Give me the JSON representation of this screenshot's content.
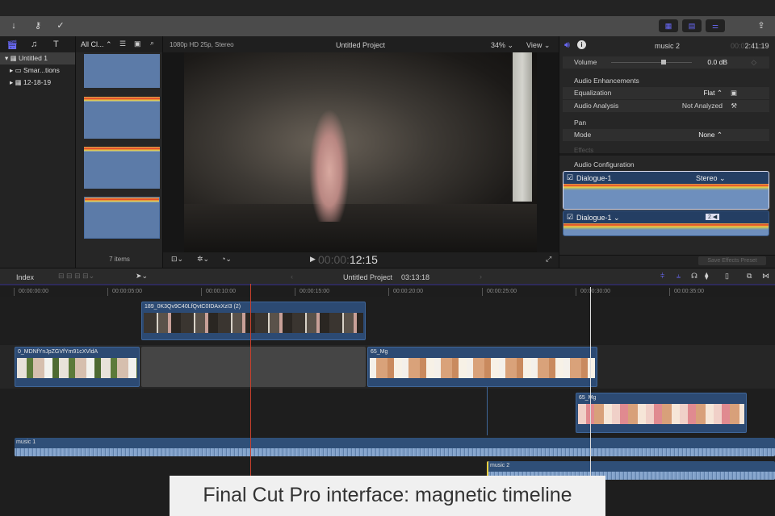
{
  "toolbar": {
    "left_icons": [
      "import-icon",
      "keyword-icon",
      "checkmark-icon"
    ],
    "right_icons": [
      "browser-layout-icon",
      "timeline-layout-icon",
      "inspector-layout-icon",
      "share-icon"
    ]
  },
  "library": {
    "items": [
      {
        "label": "Untitled 1"
      },
      {
        "label": "Smar...tions"
      },
      {
        "label": "12-18-19"
      }
    ]
  },
  "browser": {
    "filter": "All Cl...",
    "count": "7 items"
  },
  "viewer": {
    "format": "1080p HD 25p, Stereo",
    "title": "Untitled Project",
    "zoom": "34%",
    "view": "View",
    "timecode_dim": "00:00:",
    "timecode": "12:15"
  },
  "inspector": {
    "clip_name": "music 2",
    "timecode_dim": "00:0",
    "timecode": "2:41:19",
    "volume_label": "Volume",
    "volume_value": "0.0 dB",
    "volume_level": 0.62,
    "enhancements": "Audio Enhancements",
    "equalization": "Equalization",
    "eq_value": "Flat",
    "analysis": "Audio Analysis",
    "analysis_value": "Not Analyzed",
    "pan": "Pan",
    "mode": "Mode",
    "mode_value": "None",
    "effects": "Effects",
    "audio_config": "Audio Configuration",
    "channel1": "Dialogue-1",
    "channel1_mode": "Stereo",
    "channel2": "Dialogue-1",
    "channel2_badge": "2 ◀",
    "save_preset": "Save Effects Preset"
  },
  "timeline": {
    "index": "Index",
    "project": "Untitled Project",
    "duration": "03:13:18",
    "ticks": [
      "00:00:00:00",
      "00:00:05:00",
      "00:00:10:00",
      "00:00:15:00",
      "00:00:20:00",
      "00:00:25:00",
      "00:00:30:00",
      "00:00:35:00"
    ],
    "clips": {
      "connected1": "189_0K3Qv9C40LfQvtC0IDAxXzI3 (2)",
      "primary1": "0_MDNfYnJpZGVfYm91cXVldA",
      "primary2": "65_Mg",
      "connected2": "65_Mg",
      "music1": "music 1",
      "music2": "music 2"
    }
  },
  "caption": "Final Cut Pro interface: magnetic timeline"
}
